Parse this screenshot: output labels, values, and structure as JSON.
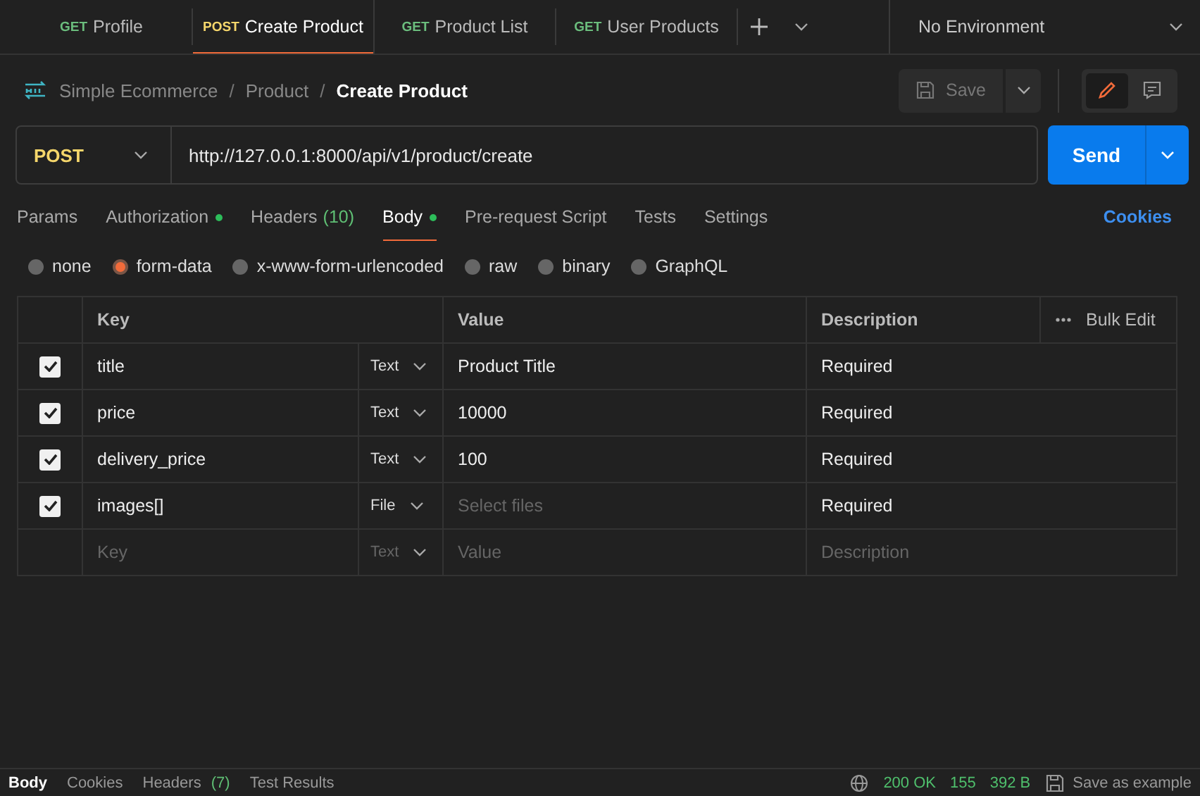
{
  "tabs": [
    {
      "method": "GET",
      "title": "Profile",
      "selected": false
    },
    {
      "method": "POST",
      "title": "Create Product",
      "selected": true
    },
    {
      "method": "GET",
      "title": "Product List",
      "selected": false
    },
    {
      "method": "GET",
      "title": "User Products",
      "selected": false
    }
  ],
  "environment": "No Environment",
  "breadcrumb": [
    "Simple Ecommerce",
    "Product",
    "Create Product"
  ],
  "breadcrumb_separator": "/",
  "view_toggle": [
    {
      "kind": "edit",
      "selected": true
    },
    {
      "kind": "comments",
      "selected": false
    }
  ],
  "save_button": "Save",
  "request": {
    "method": "POST",
    "url": "http://127.0.0.1:8000/api/v1/product/create",
    "send": "Send"
  },
  "request_tabs": [
    {
      "label": "Params",
      "selected": false
    },
    {
      "label": "Authorization",
      "selected": false,
      "dot": true
    },
    {
      "label": "Headers",
      "count": "(10)",
      "selected": false
    },
    {
      "label": "Body",
      "selected": true,
      "dot": true
    },
    {
      "label": "Pre-request Script",
      "selected": false
    },
    {
      "label": "Tests",
      "selected": false
    },
    {
      "label": "Settings",
      "selected": false
    }
  ],
  "cookies_link": "Cookies",
  "body_types": [
    {
      "label": "none",
      "selected": false
    },
    {
      "label": "form-data",
      "selected": true
    },
    {
      "label": "x-www-form-urlencoded",
      "selected": false
    },
    {
      "label": "raw",
      "selected": false
    },
    {
      "label": "binary",
      "selected": false
    },
    {
      "label": "GraphQL",
      "selected": false
    }
  ],
  "table": {
    "columns": [
      "Key",
      "Value",
      "Description"
    ],
    "bulk_edit": "Bulk Edit",
    "rows": [
      {
        "checked": true,
        "key": "title",
        "type": "Text",
        "value": "Product Title",
        "description": "Required"
      },
      {
        "checked": true,
        "key": "price",
        "type": "Text",
        "value": "10000",
        "description": "Required"
      },
      {
        "checked": true,
        "key": "delivery_price",
        "type": "Text",
        "value": "100",
        "description": "Required"
      },
      {
        "checked": true,
        "key": "images[]",
        "type": "File",
        "value_placeholder": "Select files",
        "description": "Required"
      }
    ],
    "new_row": {
      "key_placeholder": "Key",
      "type": "Text",
      "value_placeholder": "Value",
      "description_placeholder": "Description"
    }
  },
  "response_tabs": [
    {
      "label": "Body",
      "selected": true
    },
    {
      "label": "Cookies",
      "selected": false
    },
    {
      "label": "Headers",
      "count": "(7)",
      "selected": false
    },
    {
      "label": "Test Results",
      "selected": false
    }
  ],
  "response_status": {
    "status": "200 OK",
    "time": "155",
    "size": "392 B",
    "save_example": "Save as example"
  }
}
